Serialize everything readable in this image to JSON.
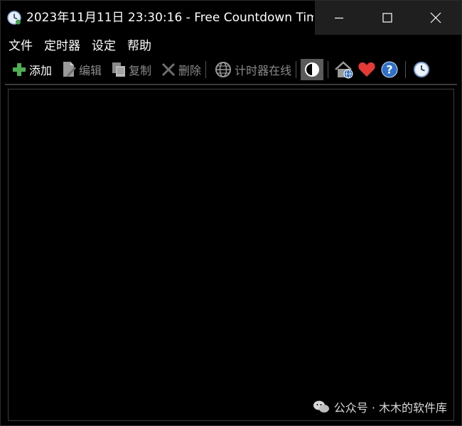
{
  "window": {
    "title": "2023年11月11日 23:30:16 - Free Countdown Tim..."
  },
  "menu": {
    "items": [
      "文件",
      "定时器",
      "设定",
      "帮助"
    ]
  },
  "toolbar": {
    "add_label": "添加",
    "edit_label": "编辑",
    "copy_label": "复制",
    "delete_label": "删除",
    "online_label": "计时器在线",
    "icons": {
      "add": "plus-icon",
      "edit": "edit-document-icon",
      "copy": "copy-icon",
      "delete": "x-icon",
      "online": "globe-icon",
      "contrast": "contrast-icon",
      "home": "home-web-icon",
      "favorite": "heart-icon",
      "help": "help-icon",
      "clock": "clock-icon"
    }
  },
  "colors": {
    "background": "#000000",
    "titlebar_controls": "#1f1f1f",
    "add_green": "#4caf50",
    "heart_red": "#e53935",
    "help_blue": "#2f6fc8",
    "disabled_text": "#8a8a8a"
  },
  "watermark": {
    "text": "公众号 · 木木的软件库"
  }
}
